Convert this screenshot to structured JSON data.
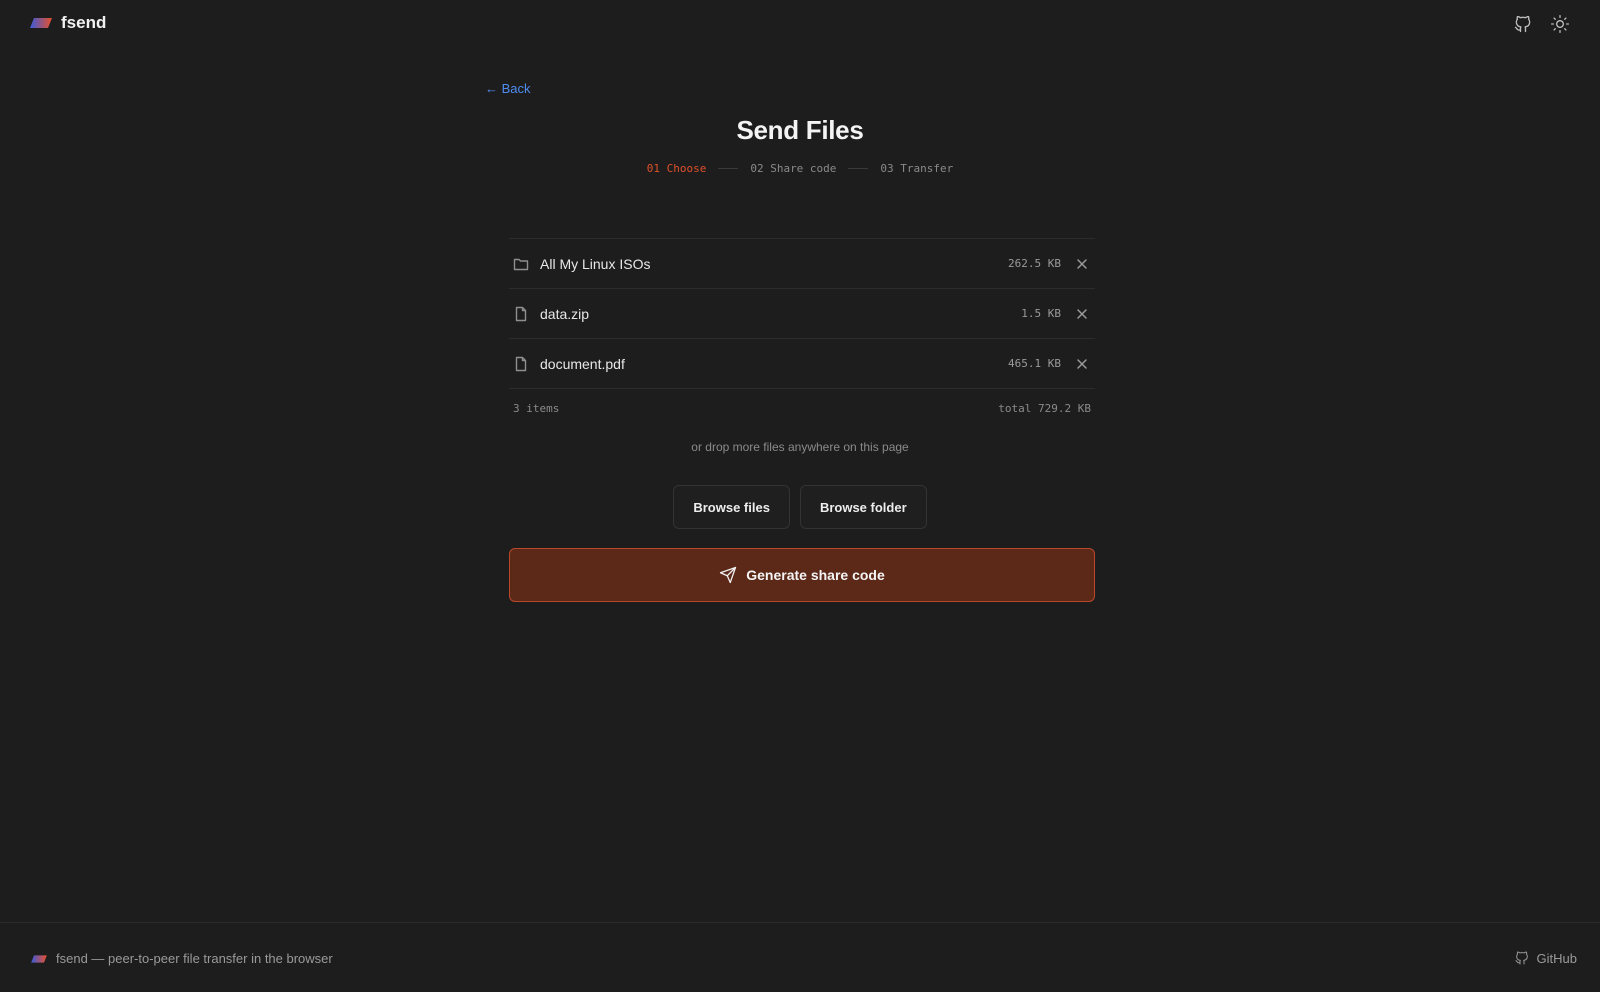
{
  "header": {
    "brand": "fsend",
    "icons": [
      "github-icon",
      "sun-icon"
    ]
  },
  "nav": {
    "back_label": "← Back"
  },
  "page": {
    "title": "Send Files"
  },
  "steps": [
    {
      "label": "01 Choose",
      "active": true
    },
    {
      "label": "02 Share code",
      "active": false
    },
    {
      "label": "03 Transfer",
      "active": false
    }
  ],
  "files": [
    {
      "name": "All My Linux ISOs",
      "size": "262.5 KB",
      "type": "folder",
      "icon": "folder-icon"
    },
    {
      "name": "data.zip",
      "size": "1.5 KB",
      "type": "file",
      "icon": "file-icon"
    },
    {
      "name": "document.pdf",
      "size": "465.1 KB",
      "type": "file",
      "icon": "file-icon"
    }
  ],
  "summary": {
    "count": "3 items",
    "total": "total 729.2 KB"
  },
  "drop_hint": "or drop more files anywhere on this page",
  "buttons": {
    "browse_files": "Browse files",
    "browse_folder": "Browse folder",
    "generate": "Generate share code"
  },
  "footer": {
    "tagline": "fsend — peer-to-peer file transfer in the browser",
    "github_label": "GitHub"
  },
  "colors": {
    "background": "#1d1d1d",
    "accent": "#e0502a",
    "link": "#4f8cf0",
    "generate_bg": "#5c2818",
    "generate_border": "#b8482a"
  }
}
